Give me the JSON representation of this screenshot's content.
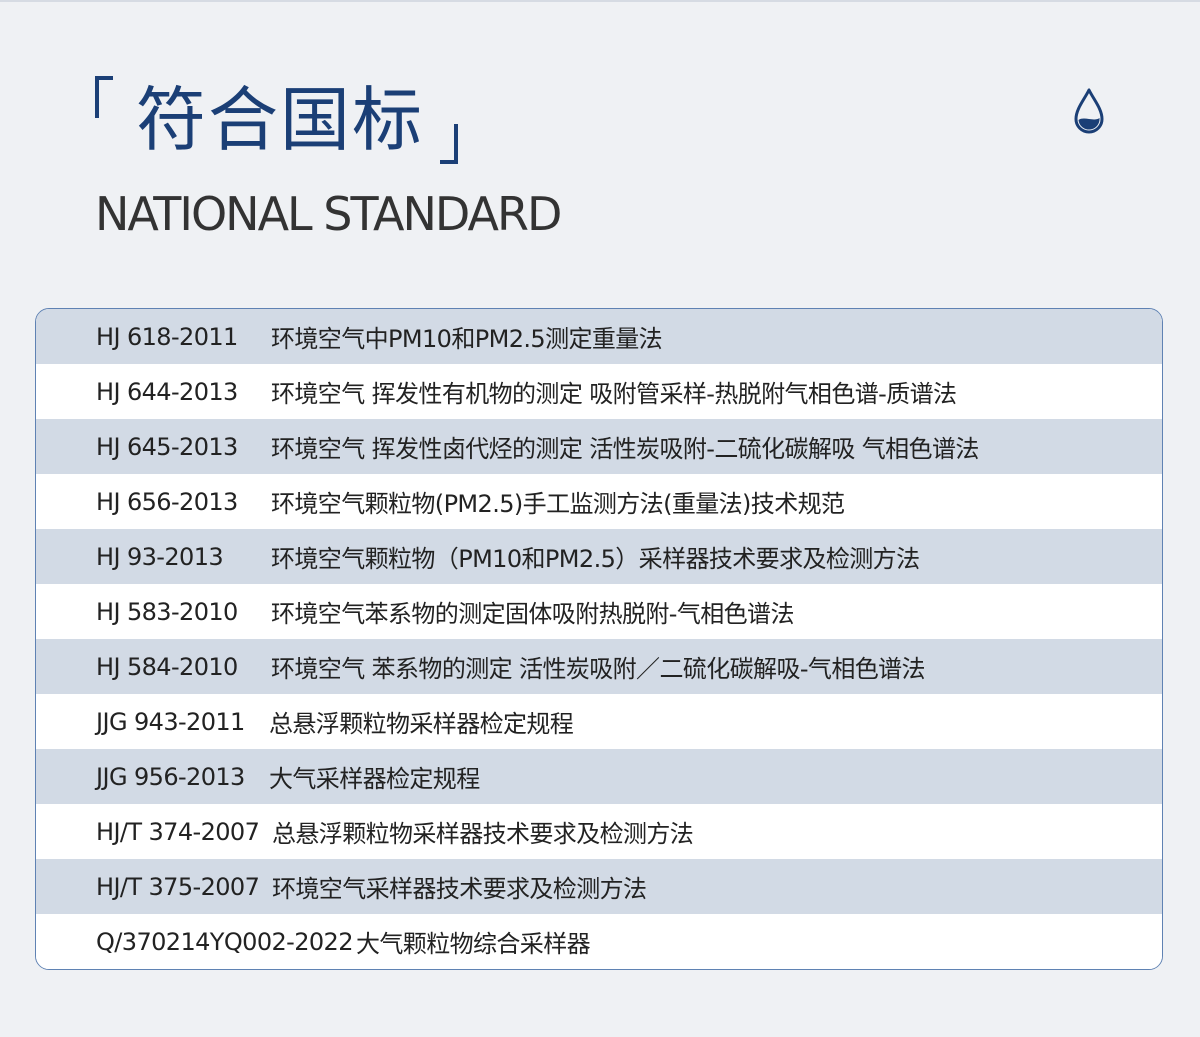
{
  "header": {
    "title": "符合国标",
    "subtitle": "NATIONAL STANDARD",
    "icon": "water-drop-icon"
  },
  "colors": {
    "accent": "#1b3f76",
    "row_shade": "#d2dae5",
    "background": "#eff1f4"
  },
  "standards": [
    {
      "code": "HJ 618-2011",
      "title": "环境空气中PM10和PM2.5测定重量法"
    },
    {
      "code": "HJ 644-2013",
      "title": "环境空气 挥发性有机物的测定 吸附管采样-热脱附气相色谱-质谱法"
    },
    {
      "code": "HJ 645-2013",
      "title": "环境空气 挥发性卤代烃的测定 活性炭吸附-二硫化碳解吸 气相色谱法"
    },
    {
      "code": "HJ 656-2013",
      "title": "环境空气颗粒物(PM2.5)手工监测方法(重量法)技术规范"
    },
    {
      "code": "HJ 93-2013",
      "title": "环境空气颗粒物（PM10和PM2.5）采样器技术要求及检测方法"
    },
    {
      "code": "HJ 583-2010",
      "title": "环境空气苯系物的测定固体吸附热脱附-气相色谱法"
    },
    {
      "code": "HJ 584-2010",
      "title": "环境空气 苯系物的测定 活性炭吸附／二硫化碳解吸-气相色谱法"
    },
    {
      "code": "JJG 943-2011",
      "title": "总悬浮颗粒物采样器检定规程"
    },
    {
      "code": "JJG 956-2013",
      "title": "大气采样器检定规程"
    },
    {
      "code": "HJ/T 374-2007",
      "title": "总悬浮颗粒物采样器技术要求及检测方法"
    },
    {
      "code": "HJ/T 375-2007",
      "title": "环境空气采样器技术要求及检测方法"
    },
    {
      "code": "Q/370214YQ002-2022",
      "title": "大气颗粒物综合采样器"
    }
  ]
}
